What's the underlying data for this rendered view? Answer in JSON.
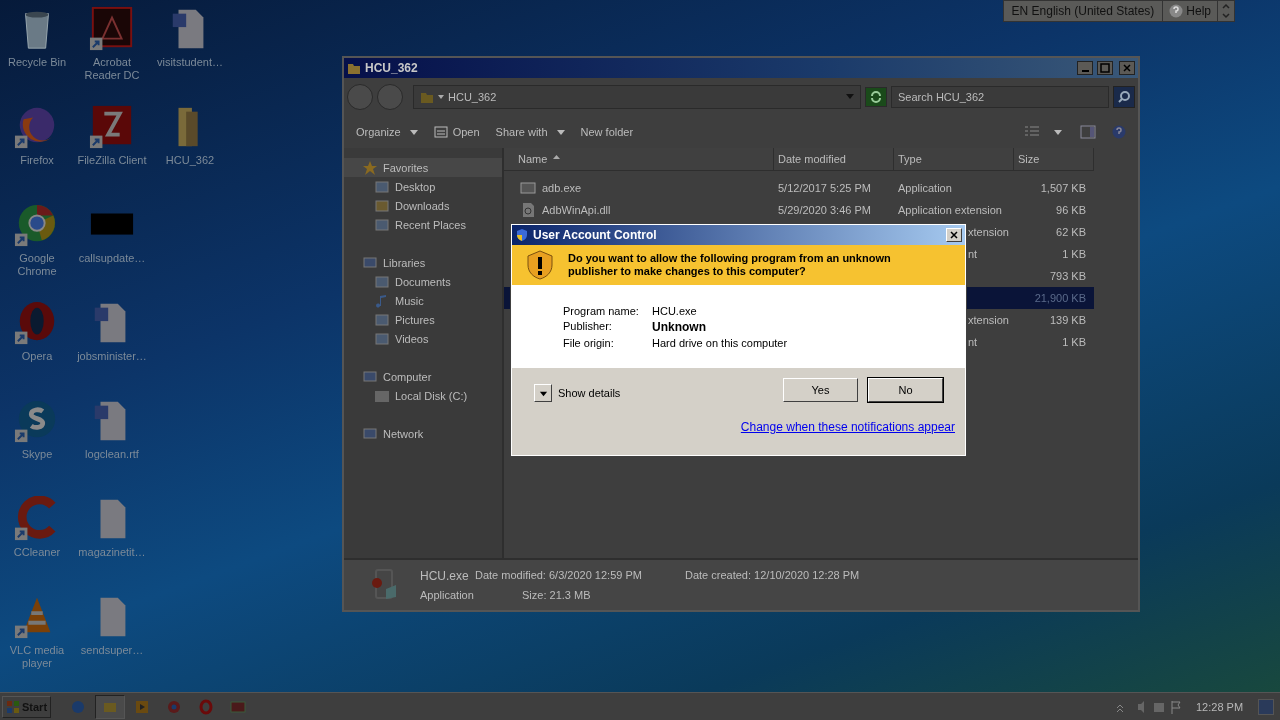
{
  "language_bar": {
    "language": "EN English (United States)",
    "help": "Help"
  },
  "desktop_icons": [
    {
      "label": "Recycle Bin",
      "kind": "bin",
      "shortcut": false
    },
    {
      "label": "Firefox",
      "kind": "firefox",
      "shortcut": true
    },
    {
      "label": "Google Chrome",
      "kind": "chrome",
      "shortcut": true
    },
    {
      "label": "Opera",
      "kind": "opera",
      "shortcut": true
    },
    {
      "label": "Skype",
      "kind": "skype",
      "shortcut": true
    },
    {
      "label": "CCleaner",
      "kind": "ccleaner",
      "shortcut": true
    },
    {
      "label": "VLC media player",
      "kind": "vlc",
      "shortcut": true
    },
    {
      "label": "Acrobat Reader DC",
      "kind": "pdf",
      "shortcut": true
    },
    {
      "label": "FileZilla Client",
      "kind": "filezilla",
      "shortcut": true
    },
    {
      "label": "callsupdate…",
      "kind": "black",
      "shortcut": false
    },
    {
      "label": "jobsminister…",
      "kind": "word",
      "shortcut": false
    },
    {
      "label": "logclean.rtf",
      "kind": "word",
      "shortcut": false
    },
    {
      "label": "magazinetit…",
      "kind": "blank",
      "shortcut": false
    },
    {
      "label": "sendsuper…",
      "kind": "blank",
      "shortcut": false
    },
    {
      "label": "visitstudent…",
      "kind": "word",
      "shortcut": false
    },
    {
      "label": "HCU_362",
      "kind": "folder",
      "shortcut": false
    }
  ],
  "explorer": {
    "title": "HCU_362",
    "address": "HCU_362",
    "search": {
      "placeholder": "Search HCU_362"
    },
    "toolbar": [
      {
        "label": "Organize",
        "kind": "dropdown"
      },
      {
        "label": "Open",
        "kind": "open"
      },
      {
        "label": "Share with",
        "kind": "dropdown"
      },
      {
        "label": "New folder",
        "kind": "plain"
      }
    ],
    "nav": [
      {
        "label": "Favorites",
        "kind": "star",
        "selected": true,
        "children": [
          {
            "label": "Desktop",
            "kind": "desktop",
            "selected": false
          },
          {
            "label": "Downloads",
            "kind": "downloads",
            "selected": false
          },
          {
            "label": "Recent Places",
            "kind": "recent",
            "selected": false
          }
        ]
      },
      {
        "label": "Libraries",
        "kind": "library",
        "selected": false,
        "children": [
          {
            "label": "Documents",
            "kind": "documents",
            "selected": false
          },
          {
            "label": "Music",
            "kind": "music",
            "selected": false
          },
          {
            "label": "Pictures",
            "kind": "pictures",
            "selected": false
          },
          {
            "label": "Videos",
            "kind": "videos",
            "selected": false
          }
        ]
      },
      {
        "label": "Computer",
        "kind": "computer",
        "selected": false,
        "children": [
          {
            "label": "Local Disk (C:)",
            "kind": "disk",
            "selected": false
          }
        ]
      },
      {
        "label": "Network",
        "kind": "network",
        "selected": false
      }
    ],
    "columns": [
      "Name",
      "Date modified",
      "Type",
      "Size"
    ],
    "rows": [
      {
        "name": "adb.exe",
        "kind": "exe",
        "date": "5/12/2017 5:25 PM",
        "type": "Application",
        "size": "1,507 KB",
        "selected": false
      },
      {
        "name": "AdbWinApi.dll",
        "kind": "dll",
        "date": "5/29/2020 3:46 PM",
        "type": "Application extension",
        "size": "96 KB",
        "selected": false
      },
      {
        "type": "xtension",
        "size": "62 KB",
        "selected": false
      },
      {
        "type": "nt",
        "size": "1 KB",
        "selected": false
      },
      {
        "size": "793 KB",
        "selected": false
      },
      {
        "size": "21,900 KB",
        "selected": true
      },
      {
        "type": "xtension",
        "size": "139 KB",
        "selected": false
      },
      {
        "type": "nt",
        "size": "1 KB",
        "selected": false
      }
    ],
    "details": {
      "name": "HCU.exe",
      "type": "Application",
      "modified": "Date modified: 6/3/2020 12:59 PM",
      "created": "Date created: 12/10/2020 12:28 PM",
      "size": "Size: 21.3 MB"
    }
  },
  "dialog": {
    "title": "User Account Control",
    "question": "Do you want to allow the following program from an unknown publisher to make changes to this computer?",
    "fields": [
      {
        "label": "Program name:",
        "value": "HCU.exe",
        "bold": false
      },
      {
        "label": "Publisher:",
        "value": "Unknown",
        "bold": true
      },
      {
        "label": "File origin:",
        "value": "Hard drive on this computer",
        "bold": false
      }
    ],
    "details_toggle": "Show details",
    "buttons": [
      {
        "label": "Yes",
        "default": false
      },
      {
        "label": "No",
        "default": true
      }
    ],
    "link": "Change when these notifications appear"
  },
  "taskbar": {
    "start": "Start",
    "apps": [
      {
        "kind": "ie",
        "active": false
      },
      {
        "kind": "explorer",
        "active": true
      },
      {
        "kind": "media",
        "active": false
      },
      {
        "kind": "chrome",
        "active": false
      },
      {
        "kind": "opera",
        "active": false
      },
      {
        "kind": "app",
        "active": false
      }
    ],
    "clock": "12:28 PM"
  }
}
